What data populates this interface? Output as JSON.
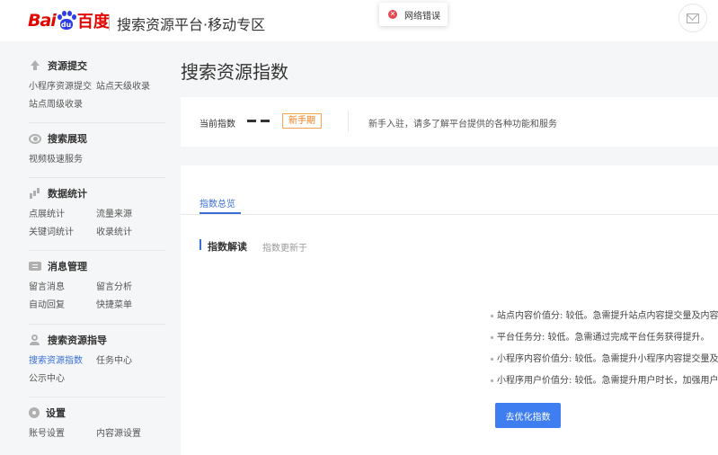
{
  "header": {
    "logo": {
      "latin": "Bai",
      "paw_text": "du",
      "cn": "百度"
    },
    "title": "搜索资源平台·移动专区",
    "toast": "网络错误",
    "mail_icon": "mail-icon"
  },
  "sidebar": {
    "groups": [
      {
        "title": "资源提交",
        "icon": "upload-icon",
        "rows": [
          [
            "小程序资源提交",
            "站点天级收录"
          ],
          [
            "站点周级收录"
          ]
        ]
      },
      {
        "title": "搜索展现",
        "icon": "eye-icon",
        "rows": [
          [
            "视频极速服务"
          ]
        ]
      },
      {
        "title": "数据统计",
        "icon": "bar-chart-icon",
        "rows": [
          [
            "点展统计",
            "流量来源"
          ],
          [
            "关键词统计",
            "收录统计"
          ]
        ]
      },
      {
        "title": "消息管理",
        "icon": "message-icon",
        "rows": [
          [
            "留言消息",
            "留言分析"
          ],
          [
            "自动回复",
            "快捷菜单"
          ]
        ]
      },
      {
        "title": "搜索资源指导",
        "icon": "person-icon",
        "rows": [
          [
            "搜索资源指数",
            "任务中心"
          ],
          [
            "公示中心"
          ]
        ]
      },
      {
        "title": "设置",
        "icon": "gear-icon",
        "rows": [
          [
            "账号设置",
            "内容源设置"
          ]
        ]
      }
    ],
    "active_item": "搜索资源指数"
  },
  "main": {
    "page_title": "搜索资源指数",
    "summary": {
      "label": "当前指数",
      "value": "——",
      "badge": "新手期",
      "tip": "新手入驻，请多了解平台提供的各种功能和服务"
    },
    "tab": "指数总览",
    "section": {
      "title": "指数解读",
      "subtitle": "指数更新于"
    },
    "bullets": [
      "站点内容价值分: 较低。急需提升站点内容提交量及内容质",
      "平台任务分: 较低。急需通过完成平台任务获得提升。",
      "小程序内容价值分: 较低。急需提升小程序内容提交量及内容",
      "小程序用户价值分: 较低。急需提升用户时长，加强用户黏"
    ],
    "button": "去优化指数"
  },
  "colors": {
    "accent": "#3a6fd8",
    "button": "#3e7ef0",
    "badge": "#f07c1b",
    "logo_red": "#e10601",
    "logo_blue": "#2d3ce4",
    "error": "#e64552"
  }
}
